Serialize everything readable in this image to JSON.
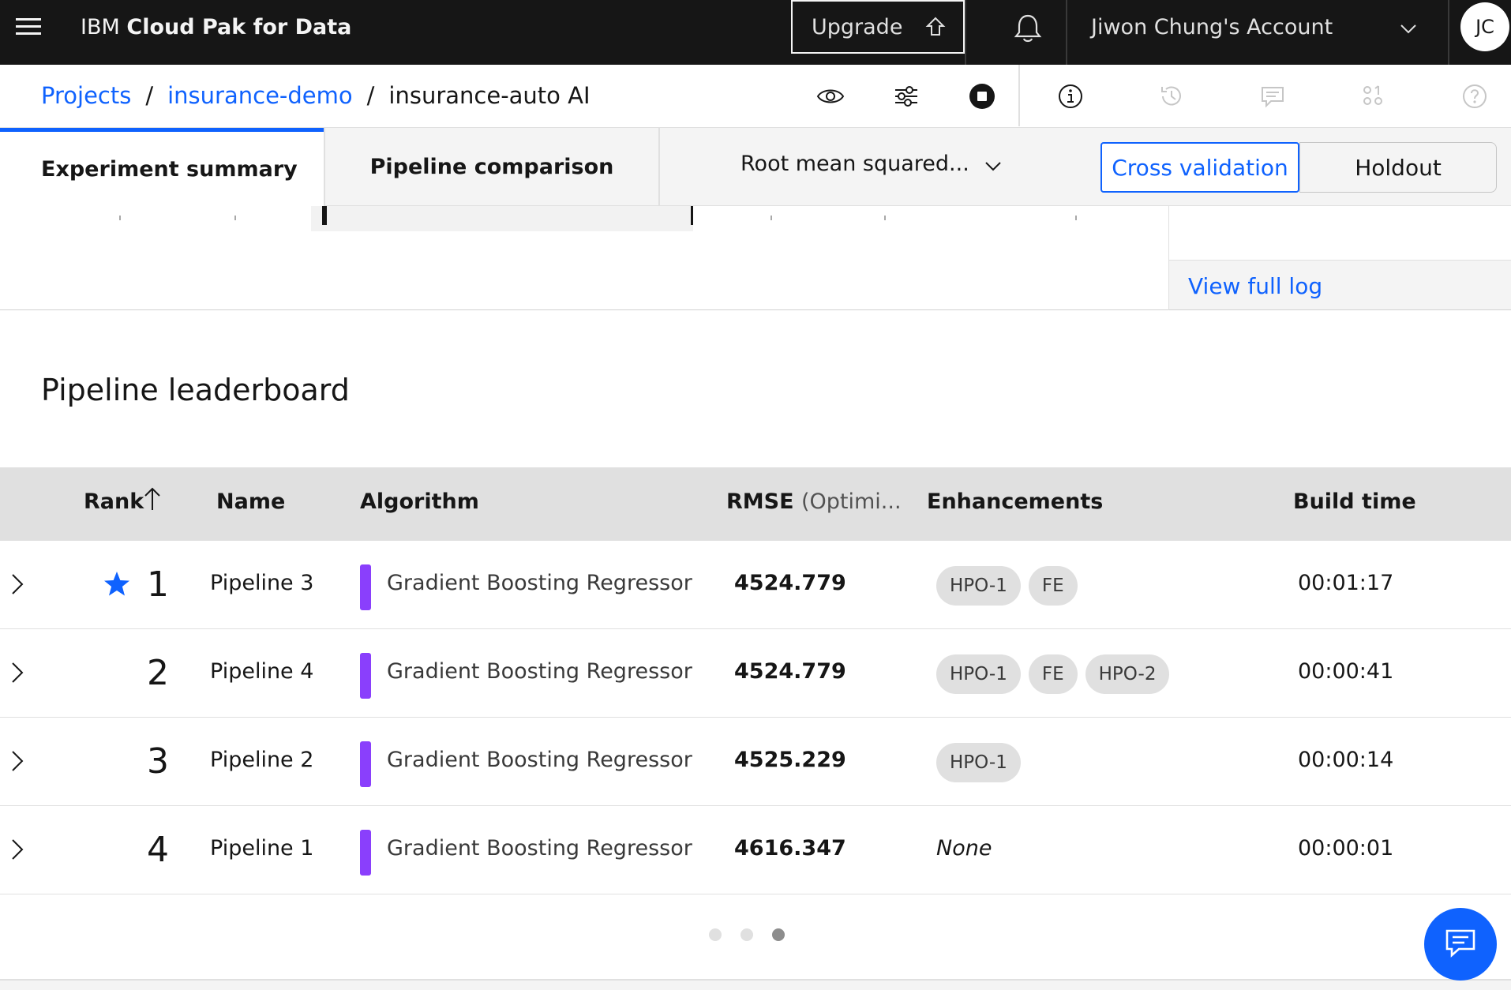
{
  "header": {
    "brand_prefix": "IBM",
    "brand_name": "Cloud Pak for Data",
    "upgrade_label": "Upgrade",
    "account_label": "Jiwon Chung's Account",
    "avatar_initials": "JC"
  },
  "breadcrumb": {
    "items": [
      "Projects",
      "insurance-demo",
      "insurance-auto AI"
    ],
    "separator": "/"
  },
  "tabs": {
    "summary_label": "Experiment summary",
    "comparison_label": "Pipeline comparison",
    "metric_selected": "Root mean squared...",
    "cross_validation_label": "Cross validation",
    "holdout_label": "Holdout"
  },
  "log": {
    "link_label": "View full log"
  },
  "leaderboard": {
    "title": "Pipeline leaderboard",
    "columns": {
      "rank": "Rank",
      "name": "Name",
      "algorithm": "Algorithm",
      "rmse": "RMSE",
      "rmse_suffix": "(Optimi...",
      "enhancements": "Enhancements",
      "build_time": "Build time"
    },
    "rows": [
      {
        "rank": "1",
        "starred": true,
        "name": "Pipeline 3",
        "algorithm": "Gradient Boosting Regressor",
        "rmse": "4524.779",
        "enhancements": [
          "HPO-1",
          "FE"
        ],
        "build_time": "00:01:17"
      },
      {
        "rank": "2",
        "starred": false,
        "name": "Pipeline 4",
        "algorithm": "Gradient Boosting Regressor",
        "rmse": "4524.779",
        "enhancements": [
          "HPO-1",
          "FE",
          "HPO-2"
        ],
        "build_time": "00:00:41"
      },
      {
        "rank": "3",
        "starred": false,
        "name": "Pipeline 2",
        "algorithm": "Gradient Boosting Regressor",
        "rmse": "4525.229",
        "enhancements": [
          "HPO-1"
        ],
        "build_time": "00:00:14"
      },
      {
        "rank": "4",
        "starred": false,
        "name": "Pipeline 1",
        "algorithm": "Gradient Boosting Regressor",
        "rmse": "4616.347",
        "enhancements": [],
        "enhancements_empty": "None",
        "build_time": "00:00:01"
      }
    ]
  },
  "pagination": {
    "pages": 3,
    "current_page": 3
  },
  "colors": {
    "accent": "#0f62fe",
    "algorithm_bar": "#8a3ffc",
    "header_bg": "#161616"
  }
}
